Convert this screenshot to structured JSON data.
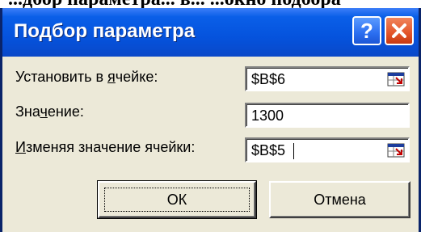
{
  "top_clipped_text": "...дбор параметра... в... ...окно подбора",
  "dialog": {
    "title": "Подбор параметра",
    "help_button": "?",
    "fields": {
      "set_cell": {
        "label_pre": "Установить в ",
        "label_ul": "я",
        "label_post": "чейке:",
        "value": "$B$6"
      },
      "to_value": {
        "label_pre": "Зна",
        "label_ul": "ч",
        "label_post": "ение:",
        "value": "1300"
      },
      "changing_cell": {
        "label_pre": "",
        "label_ul": "И",
        "label_post": "зменяя значение ячейки:",
        "value": "$B$5"
      }
    },
    "ok_label": "ОК",
    "cancel_label": "Отмена"
  }
}
